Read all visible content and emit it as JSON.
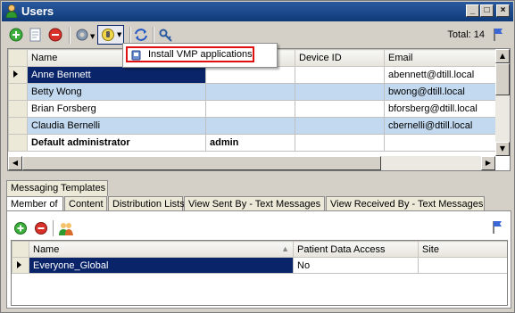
{
  "window": {
    "title": "Users"
  },
  "toolbar": {
    "total_text": "Total: 14",
    "icons": [
      "add-icon",
      "edit-icon",
      "delete-icon",
      "settings-dropdown-icon",
      "install-dropdown-icon",
      "refresh-icon",
      "key-icon",
      "flag-icon"
    ]
  },
  "dropdown_menu": {
    "item_label": "Install VMP applications"
  },
  "users_grid": {
    "columns": [
      "Name",
      "",
      "Device ID",
      "Email"
    ],
    "rows": [
      {
        "name": "Anne Bennett",
        "col2": "",
        "device_id": "",
        "email": "abennett@dtill.local",
        "style": "selected"
      },
      {
        "name": "Betty Wong",
        "col2": "",
        "device_id": "",
        "email": "bwong@dtill.local",
        "style": "alt"
      },
      {
        "name": "Brian Forsberg",
        "col2": "",
        "device_id": "",
        "email": "bforsberg@dtill.local",
        "style": "normal"
      },
      {
        "name": "Claudia Bernelli",
        "col2": "",
        "device_id": "",
        "email": "cbernelli@dtill.local",
        "style": "alt"
      },
      {
        "name": "Default administrator",
        "col2": "admin",
        "device_id": "",
        "email": "",
        "style": "bold"
      }
    ]
  },
  "tabs_row1": [
    "Messaging Templates"
  ],
  "tabs_row2": [
    "Member of",
    "Content",
    "Distribution Lists",
    "View Sent By - Text Messages",
    "View Received By - Text Messages"
  ],
  "membership_grid": {
    "columns": [
      "Name",
      "Patient Data Access",
      "Site"
    ],
    "rows": [
      {
        "name": "Everyone_Global",
        "patient_data_access": "No",
        "site": ""
      }
    ]
  },
  "colors": {
    "title_bar": "#0f3a78",
    "selected_row": "#0a246a",
    "alt_row": "#c2d9ef",
    "highlight_box": "#e01010"
  }
}
